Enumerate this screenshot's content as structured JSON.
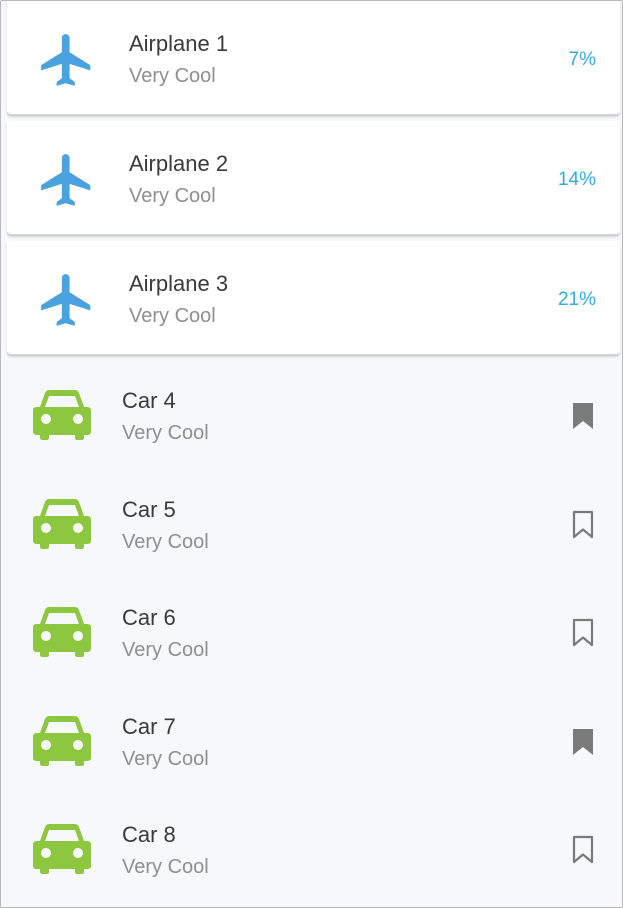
{
  "colors": {
    "airplane_icon": "#4aa3df",
    "car_icon": "#8dc63f",
    "percent_text": "#34aadc",
    "bookmark": "#7a7a7a"
  },
  "airplanes": [
    {
      "icon": "airplane-icon",
      "title": "Airplane 1",
      "subtitle": "Very Cool",
      "percent": "7%"
    },
    {
      "icon": "airplane-icon",
      "title": "Airplane 2",
      "subtitle": "Very Cool",
      "percent": "14%"
    },
    {
      "icon": "airplane-icon",
      "title": "Airplane 3",
      "subtitle": "Very Cool",
      "percent": "21%"
    }
  ],
  "cars": [
    {
      "icon": "car-icon",
      "title": "Car 4",
      "subtitle": "Very Cool",
      "bookmarked": true
    },
    {
      "icon": "car-icon",
      "title": "Car 5",
      "subtitle": "Very Cool",
      "bookmarked": false
    },
    {
      "icon": "car-icon",
      "title": "Car 6",
      "subtitle": "Very Cool",
      "bookmarked": false
    },
    {
      "icon": "car-icon",
      "title": "Car 7",
      "subtitle": "Very Cool",
      "bookmarked": true
    },
    {
      "icon": "car-icon",
      "title": "Car 8",
      "subtitle": "Very Cool",
      "bookmarked": false
    }
  ]
}
